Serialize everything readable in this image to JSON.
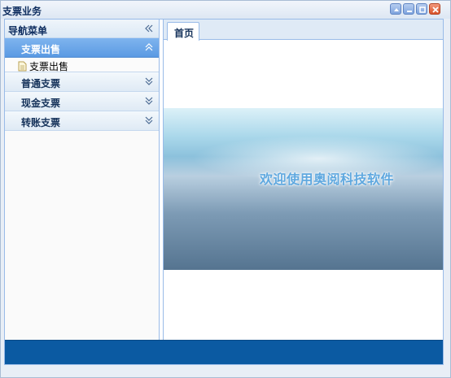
{
  "window": {
    "title": "支票业务"
  },
  "nav": {
    "title": "导航菜单",
    "sections": [
      {
        "label": "支票出售",
        "active": true,
        "items": [
          "支票出售"
        ]
      },
      {
        "label": "普通支票",
        "active": false
      },
      {
        "label": "现金支票",
        "active": false
      },
      {
        "label": "转账支票",
        "active": false
      }
    ]
  },
  "tabs": [
    {
      "label": "首页"
    }
  ],
  "banner": {
    "text": "欢迎使用奥阅科技软件"
  },
  "colors": {
    "accent": "#5a9ae3",
    "footer": "#0b5aa2",
    "border": "#99bbe8"
  }
}
